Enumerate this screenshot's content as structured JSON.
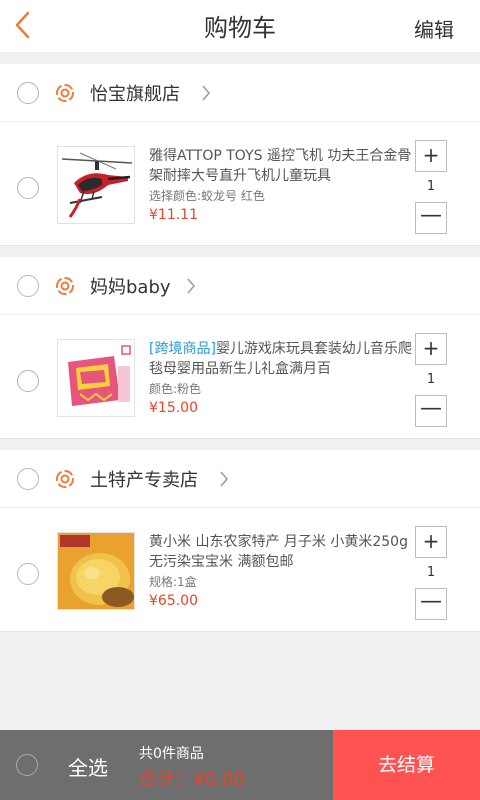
{
  "header": {
    "title": "购物车",
    "edit_label": "编辑"
  },
  "stores": [
    {
      "name": "怡宝旗舰店",
      "item": {
        "tag": "",
        "title": "雅得ATTOP TOYS 遥控飞机 功夫王合金骨架耐摔大号直升飞机儿童玩具",
        "spec": "选择颜色:蛟龙号 红色",
        "price": "¥11.11",
        "quantity": "1",
        "image": "helicopter"
      }
    },
    {
      "name": "妈妈baby",
      "item": {
        "tag": "[跨境商品]",
        "title": "婴儿游戏床玩具套装幼儿音乐爬毯母婴用品新生儿礼盒满月百",
        "spec": "颜色:粉色",
        "price": "¥15.00",
        "quantity": "1",
        "image": "baby-playmat"
      }
    },
    {
      "name": "土特产专卖店",
      "item": {
        "tag": "",
        "title": "黄小米 山东农家特产 月子米 小黄米250g无污染宝宝米 满额包邮",
        "spec": "规格:1盒",
        "price": "¥65.00",
        "quantity": "1",
        "image": "millet"
      }
    }
  ],
  "qty_controls": {
    "plus": "+",
    "minus": "—"
  },
  "footer": {
    "select_all": "全选",
    "count": "共0件商品",
    "total": "合计：¥0.00",
    "checkout": "去结算"
  },
  "colors": {
    "accent": "#ff5352",
    "price": "#e8442a",
    "tag": "#2a9ad6",
    "footer_bg": "#6e6e6e"
  }
}
